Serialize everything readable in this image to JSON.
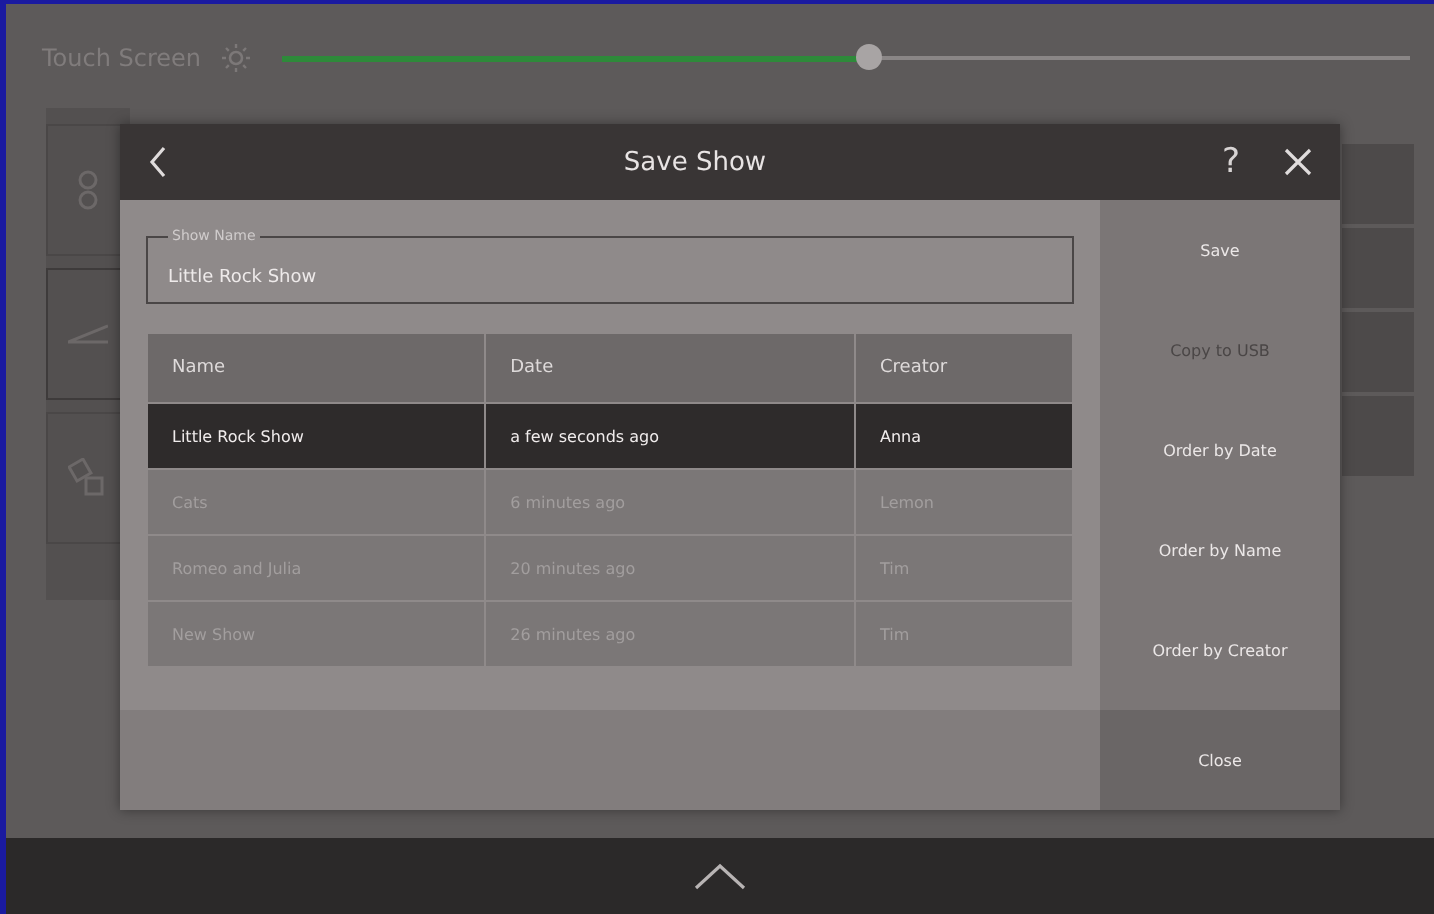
{
  "background": {
    "title": "Touch Screen",
    "brightness": {
      "level": 0.52
    }
  },
  "dialog": {
    "title": "Save Show",
    "help": "?",
    "show_name": {
      "label": "Show Name",
      "value": "Little Rock Show"
    },
    "table": {
      "columns": [
        "Name",
        "Date",
        "Creator"
      ],
      "rows": [
        {
          "cells": [
            "Little Rock Show",
            "a few seconds ago",
            "Anna"
          ],
          "selected": true
        },
        {
          "cells": [
            "Cats",
            "6 minutes ago",
            "Lemon"
          ],
          "selected": false
        },
        {
          "cells": [
            "Romeo and Julia",
            "20 minutes ago",
            "Tim"
          ],
          "selected": false
        },
        {
          "cells": [
            "New Show",
            "26 minutes ago",
            "Tim"
          ],
          "selected": false
        }
      ]
    },
    "buttons": [
      {
        "label": "Save",
        "disabled": false
      },
      {
        "label": "Copy to USB",
        "disabled": true
      },
      {
        "label": "Order by Date",
        "disabled": false
      },
      {
        "label": "Order by Name",
        "disabled": false
      },
      {
        "label": "Order by Creator",
        "disabled": false
      }
    ],
    "close": "Close"
  }
}
